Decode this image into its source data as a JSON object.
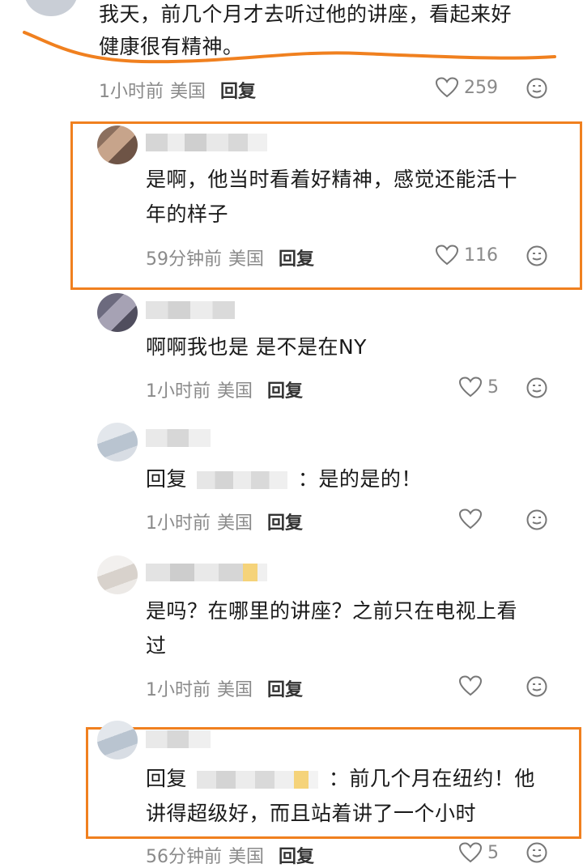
{
  "comments": [
    {
      "text": "我天，前几个月才去听过他的讲座，看起来好健康很有精神。",
      "line1": "我天，前几个月才去听过他的讲座，看起来好",
      "line2": "健康很有精神。",
      "time": "1小时前",
      "location": "美国",
      "reply_label": "回复",
      "likes": "259"
    },
    {
      "line1": "是啊，他当时看着好精神，感觉还能活十",
      "line2": "年的样子",
      "time": "59分钟前",
      "location": "美国",
      "reply_label": "回复",
      "likes": "116"
    },
    {
      "line1": "啊啊我也是 是不是在NY",
      "time": "1小时前",
      "location": "美国",
      "reply_label": "回复",
      "likes": "5"
    },
    {
      "prefix": "回复",
      "suffix": "：是的是的！",
      "time": "1小时前",
      "location": "美国",
      "reply_label": "回复",
      "likes": ""
    },
    {
      "line1": "是吗？在哪里的讲座？之前只在电视上看",
      "line2": "过",
      "time": "1小时前",
      "location": "美国",
      "reply_label": "回复",
      "likes": ""
    },
    {
      "prefix": "回复",
      "suffix": "：前几个月在纽约！他",
      "line2": "讲得超级好，而且站着讲了一个小时",
      "time": "56分钟前",
      "location": "美国",
      "reply_label": "回复",
      "likes": "5"
    }
  ],
  "colors": {
    "highlight": "#f0801f",
    "meta": "#8a8a8a"
  },
  "icons": {
    "like": "heart-outline-icon",
    "emoji": "emoji-face-icon"
  }
}
